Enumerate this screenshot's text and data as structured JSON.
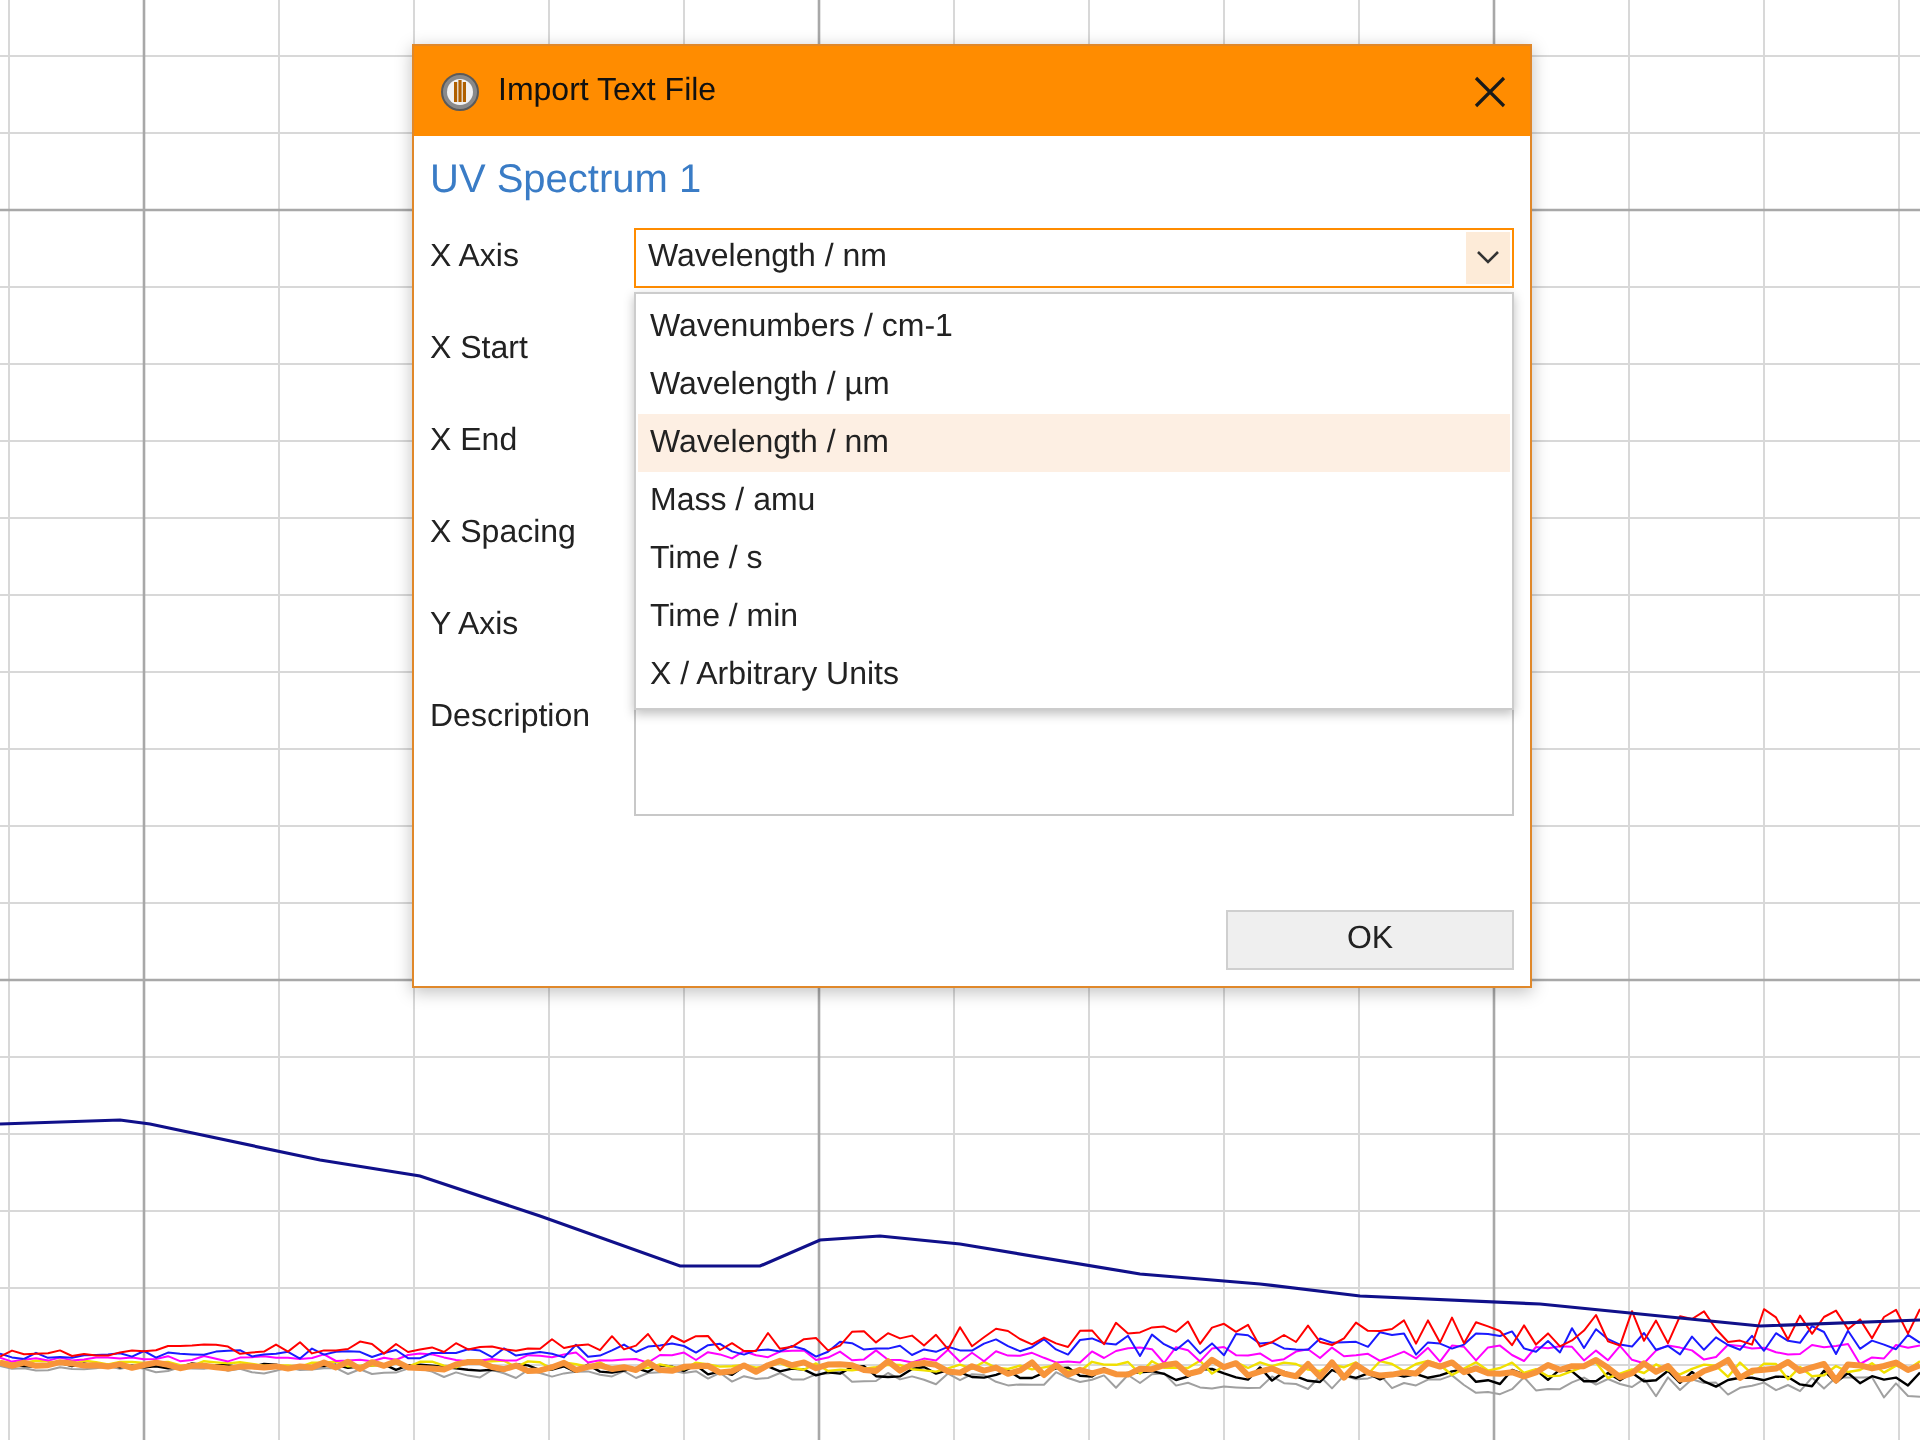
{
  "window": {
    "title": "Import Text File"
  },
  "heading": "UV Spectrum 1",
  "fields": [
    {
      "label": "X Axis",
      "kind": "combo",
      "value": "Wavelength / nm",
      "open": true
    },
    {
      "label": "X Start",
      "kind": "covered"
    },
    {
      "label": "X End",
      "kind": "covered"
    },
    {
      "label": "X Spacing",
      "kind": "covered"
    },
    {
      "label": "Y Axis",
      "kind": "covered"
    },
    {
      "label": "Description",
      "kind": "textarea"
    }
  ],
  "options": [
    {
      "label": "Wavenumbers / cm-1",
      "selected": false
    },
    {
      "label": "Wavelength / µm",
      "selected": false
    },
    {
      "label": "Wavelength / nm",
      "selected": true
    },
    {
      "label": "Mass / amu",
      "selected": false
    },
    {
      "label": "Time / s",
      "selected": false
    },
    {
      "label": "Time / min",
      "selected": false
    },
    {
      "label": "X / Arbitrary Units",
      "selected": false
    }
  ],
  "buttons": [
    "OK"
  ]
}
